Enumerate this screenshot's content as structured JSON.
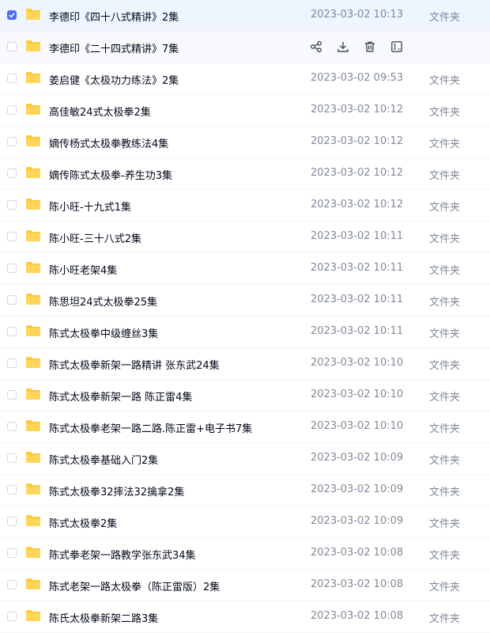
{
  "files": [
    {
      "name": "李德印《四十八式精讲》2集",
      "date": "2023-03-02 10:13",
      "type": "文件夹",
      "checked": true
    },
    {
      "name": "李德印《二十四式精讲》7集",
      "date": "",
      "type": "",
      "checked": false,
      "hover": true
    },
    {
      "name": "姜启健《太极功力练法》2集",
      "date": "2023-03-02 09:53",
      "type": "文件夹",
      "checked": false
    },
    {
      "name": "高佳敏24式太极拳2集",
      "date": "2023-03-02 10:12",
      "type": "文件夹",
      "checked": false
    },
    {
      "name": "嫡传杨式太极拳教练法4集",
      "date": "2023-03-02 10:12",
      "type": "文件夹",
      "checked": false
    },
    {
      "name": "嫡传陈式太极拳-养生功3集",
      "date": "2023-03-02 10:12",
      "type": "文件夹",
      "checked": false
    },
    {
      "name": "陈小旺-十九式1集",
      "date": "2023-03-02 10:12",
      "type": "文件夹",
      "checked": false
    },
    {
      "name": "陈小旺-三十八式2集",
      "date": "2023-03-02 10:11",
      "type": "文件夹",
      "checked": false
    },
    {
      "name": "陈小旺老架4集",
      "date": "2023-03-02 10:11",
      "type": "文件夹",
      "checked": false
    },
    {
      "name": "陈思坦24式太极拳25集",
      "date": "2023-03-02 10:11",
      "type": "文件夹",
      "checked": false
    },
    {
      "name": "陈式太极拳中级缠丝3集",
      "date": "2023-03-02 10:11",
      "type": "文件夹",
      "checked": false
    },
    {
      "name": "陈式太极拳新架一路精讲 张东武24集",
      "date": "2023-03-02 10:10",
      "type": "文件夹",
      "checked": false
    },
    {
      "name": "陈式太极拳新架一路 陈正雷4集",
      "date": "2023-03-02 10:10",
      "type": "文件夹",
      "checked": false
    },
    {
      "name": "陈式太极拳老架一路二路.陈正雷+电子书7集",
      "date": "2023-03-02 10:10",
      "type": "文件夹",
      "checked": false
    },
    {
      "name": "陈式太极拳基础入门2集",
      "date": "2023-03-02 10:09",
      "type": "文件夹",
      "checked": false
    },
    {
      "name": "陈式太极拳32摔法32擒拿2集",
      "date": "2023-03-02 10:09",
      "type": "文件夹",
      "checked": false
    },
    {
      "name": "陈式太极拳2集",
      "date": "2023-03-02 10:09",
      "type": "文件夹",
      "checked": false
    },
    {
      "name": "陈式拳老架一路教学张东武34集",
      "date": "2023-03-02 10:08",
      "type": "文件夹",
      "checked": false
    },
    {
      "name": "陈式老架一路太极拳（陈正雷版）2集",
      "date": "2023-03-02 10:08",
      "type": "文件夹",
      "checked": false
    },
    {
      "name": "陈氏太极拳新架二路3集",
      "date": "2023-03-02 10:08",
      "type": "文件夹",
      "checked": false
    }
  ],
  "row_actions": [
    "share-icon",
    "download-icon",
    "delete-icon",
    "rename-icon"
  ],
  "colors": {
    "folder": "#ffc93a",
    "accent": "#4e6ef2",
    "meta_text": "#818999"
  }
}
